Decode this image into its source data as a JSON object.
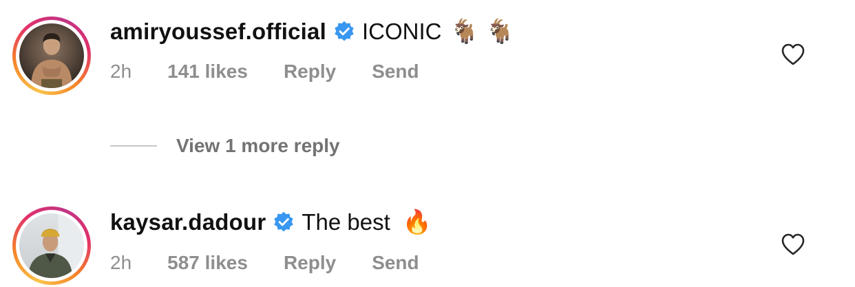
{
  "comments": [
    {
      "username": "amiryoussef.official",
      "verified": true,
      "text": "ICONIC",
      "emojis": "🐐 🐐",
      "time": "2h",
      "likes": "141 likes",
      "reply_label": "Reply",
      "send_label": "Send"
    },
    {
      "username": "kaysar.dadour",
      "verified": true,
      "text": "The best",
      "emojis": "🔥",
      "time": "2h",
      "likes": "587 likes",
      "reply_label": "Reply",
      "send_label": "Send"
    }
  ],
  "view_more_replies": "View 1 more reply",
  "colors": {
    "verified": "#3897f0",
    "meta_text": "#8e8e8e",
    "view_more_text": "#737373"
  }
}
